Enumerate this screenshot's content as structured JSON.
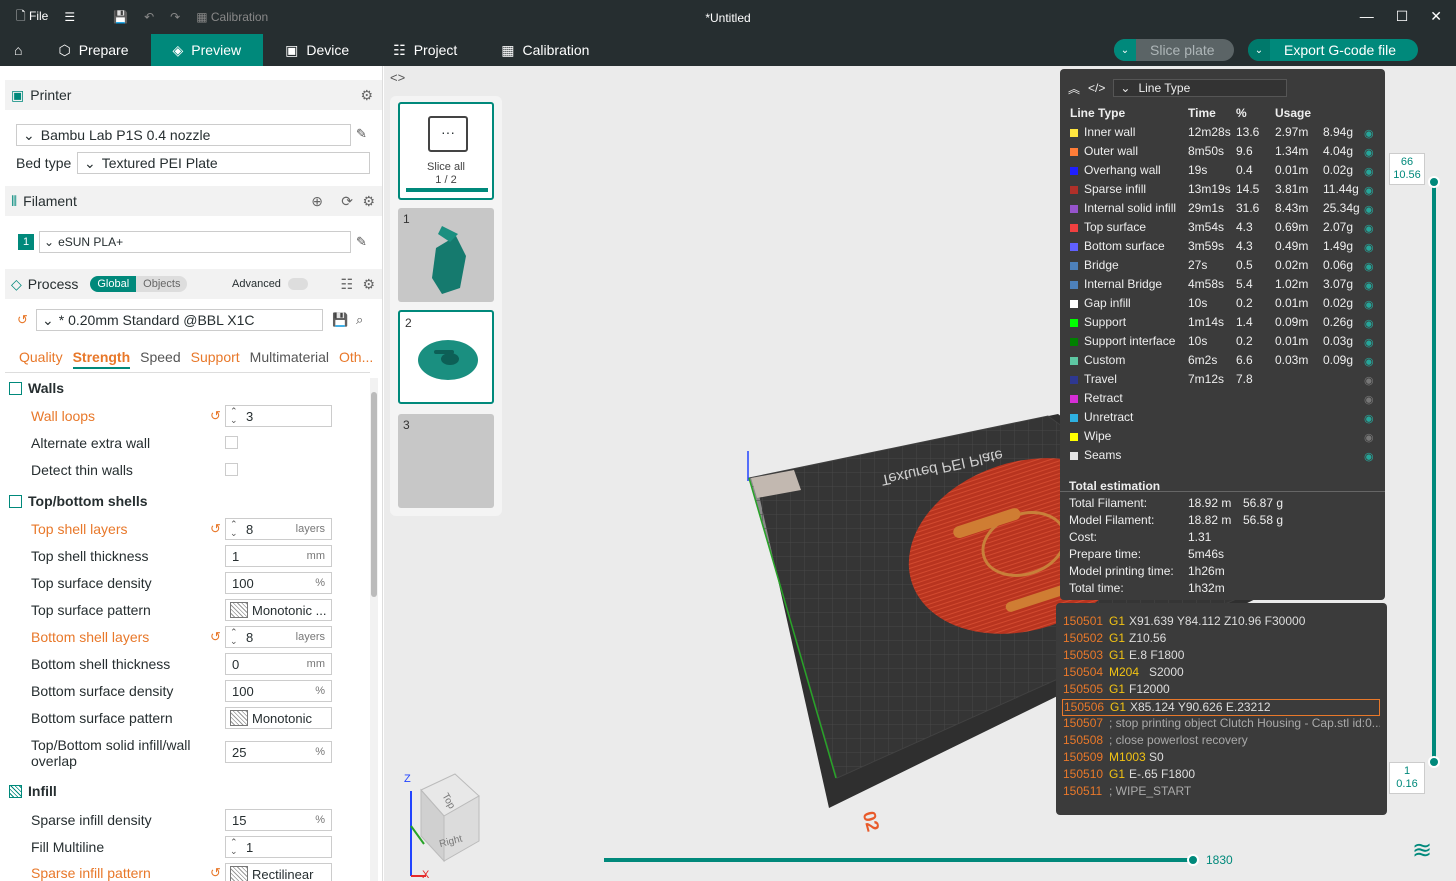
{
  "titlebar": {
    "file_label": "File",
    "calibration_label": "Calibration",
    "title": "*Untitled"
  },
  "nav": {
    "items": [
      {
        "label": "Prepare"
      },
      {
        "label": "Preview"
      },
      {
        "label": "Device"
      },
      {
        "label": "Project"
      },
      {
        "label": "Calibration"
      }
    ],
    "slice_label": "Slice plate",
    "export_label": "Export G-code file"
  },
  "printer": {
    "header": "Printer",
    "model": "Bambu Lab P1S 0.4 nozzle",
    "bed_label": "Bed type",
    "bed_value": "Textured PEI Plate"
  },
  "filament": {
    "header": "Filament",
    "slot": "1",
    "name": "eSUN PLA+"
  },
  "process": {
    "header": "Process",
    "global": "Global",
    "objects": "Objects",
    "advanced": "Advanced",
    "preset": "* 0.20mm Standard @BBL X1C",
    "tabs": [
      "Quality",
      "Strength",
      "Speed",
      "Support",
      "Multimaterial",
      "Oth..."
    ]
  },
  "walls": {
    "header": "Walls",
    "wall_loops": "Wall loops",
    "wall_loops_value": "3",
    "alt_extra": "Alternate extra wall",
    "thin": "Detect thin walls"
  },
  "shells": {
    "header": "Top/bottom shells",
    "rows": [
      {
        "label": "Top shell layers",
        "value": "8",
        "unit": "layers"
      },
      {
        "label": "Top shell thickness",
        "value": "1",
        "unit": "mm"
      },
      {
        "label": "Top surface density",
        "value": "100",
        "unit": "%"
      },
      {
        "label": "Top surface pattern",
        "value": "Monotonic ...",
        "unit": ""
      },
      {
        "label": "Bottom shell layers",
        "value": "8",
        "unit": "layers"
      },
      {
        "label": "Bottom shell thickness",
        "value": "0",
        "unit": "mm"
      },
      {
        "label": "Bottom surface density",
        "value": "100",
        "unit": "%"
      },
      {
        "label": "Bottom surface pattern",
        "value": "Monotonic",
        "unit": ""
      }
    ],
    "overlap_l1": "Top/Bottom solid infill/wall",
    "overlap_l2": "overlap",
    "overlap_value": "25",
    "overlap_unit": "%"
  },
  "infill": {
    "header": "Infill",
    "density": "Sparse infill density",
    "density_value": "15",
    "density_unit": "%",
    "multiline": "Fill Multiline",
    "multiline_value": "1",
    "pattern": "Sparse infill pattern",
    "pattern_value": "Rectilinear"
  },
  "plates": {
    "slice_all": "Slice all",
    "progress": "1 / 2",
    "p1": "1",
    "p2": "2",
    "p3": "3"
  },
  "linetype": {
    "selector": "Line Type",
    "cols": {
      "type": "Line Type",
      "time": "Time",
      "pct": "%",
      "usage": "Usage"
    },
    "rows": [
      {
        "name": "Inner wall",
        "color": "#ffe640",
        "time": "12m28s",
        "pct": "13.6",
        "len": "2.97m",
        "w": "8.94g"
      },
      {
        "name": "Outer wall",
        "color": "#ff7d38",
        "time": "8m50s",
        "pct": "9.6",
        "len": "1.34m",
        "w": "4.04g"
      },
      {
        "name": "Overhang wall",
        "color": "#1f1fff",
        "time": "19s",
        "pct": "0.4",
        "len": "0.01m",
        "w": "0.02g"
      },
      {
        "name": "Sparse infill",
        "color": "#b03029",
        "time": "13m19s",
        "pct": "14.5",
        "len": "3.81m",
        "w": "11.44g"
      },
      {
        "name": "Internal solid infill",
        "color": "#9654cc",
        "time": "29m1s",
        "pct": "31.6",
        "len": "8.43m",
        "w": "25.34g"
      },
      {
        "name": "Top surface",
        "color": "#f04040",
        "time": "3m54s",
        "pct": "4.3",
        "len": "0.69m",
        "w": "2.07g"
      },
      {
        "name": "Bottom surface",
        "color": "#6060ff",
        "time": "3m59s",
        "pct": "4.3",
        "len": "0.49m",
        "w": "1.49g"
      },
      {
        "name": "Bridge",
        "color": "#4d80ba",
        "time": "27s",
        "pct": "0.5",
        "len": "0.02m",
        "w": "0.06g"
      },
      {
        "name": "Internal Bridge",
        "color": "#4d80ba",
        "time": "4m58s",
        "pct": "5.4",
        "len": "1.02m",
        "w": "3.07g"
      },
      {
        "name": "Gap infill",
        "color": "#ffffff",
        "time": "10s",
        "pct": "0.2",
        "len": "0.01m",
        "w": "0.02g"
      },
      {
        "name": "Support",
        "color": "#00ff00",
        "time": "1m14s",
        "pct": "1.4",
        "len": "0.09m",
        "w": "0.26g"
      },
      {
        "name": "Support interface",
        "color": "#008000",
        "time": "10s",
        "pct": "0.2",
        "len": "0.01m",
        "w": "0.03g"
      },
      {
        "name": "Custom",
        "color": "#5ec7a3",
        "time": "6m2s",
        "pct": "6.6",
        "len": "0.03m",
        "w": "0.09g"
      },
      {
        "name": "Travel",
        "color": "#2e3891",
        "time": "7m12s",
        "pct": "7.8",
        "len": "",
        "w": ""
      },
      {
        "name": "Retract",
        "color": "#d62ed6",
        "time": "",
        "pct": "",
        "len": "",
        "w": ""
      },
      {
        "name": "Unretract",
        "color": "#2eb0e0",
        "time": "",
        "pct": "",
        "len": "",
        "w": ""
      },
      {
        "name": "Wipe",
        "color": "#ffff00",
        "time": "",
        "pct": "",
        "len": "",
        "w": ""
      },
      {
        "name": "Seams",
        "color": "#e6e6e6",
        "time": "",
        "pct": "",
        "len": "",
        "w": ""
      }
    ],
    "est_header": "Total estimation",
    "est": [
      {
        "k": "Total Filament:",
        "a": "18.92 m",
        "b": "56.87 g"
      },
      {
        "k": "Model Filament:",
        "a": "18.82 m",
        "b": "56.58 g"
      },
      {
        "k": "Cost:",
        "a": "1.31",
        "b": ""
      },
      {
        "k": "Prepare time:",
        "a": "5m46s",
        "b": ""
      },
      {
        "k": "Model printing time:",
        "a": "1h26m",
        "b": ""
      },
      {
        "k": "Total time:",
        "a": "1h32m",
        "b": ""
      }
    ]
  },
  "gcode": [
    {
      "ln": "150501",
      "cmd": "G1",
      "args": "X91.639 Y84.112 Z10.96 F30000"
    },
    {
      "ln": "150502",
      "cmd": "G1",
      "args": "Z10.56"
    },
    {
      "ln": "150503",
      "cmd": "G1",
      "args": "E.8 F1800"
    },
    {
      "ln": "150504",
      "cmd": "M204",
      "args": "S2000"
    },
    {
      "ln": "150505",
      "cmd": "G1",
      "args": "F12000"
    },
    {
      "ln": "150506",
      "cmd": "G1",
      "args": "X85.124 Y90.626 E.23212"
    },
    {
      "ln": "150507",
      "cmd": "",
      "args": "; stop printing object Clutch Housing - Cap.stl id:0..."
    },
    {
      "ln": "150508",
      "cmd": "",
      "args": "; close powerlost recovery"
    },
    {
      "ln": "150509",
      "cmd": "M1003",
      "args": "S0"
    },
    {
      "ln": "150510",
      "cmd": "G1",
      "args": "E-.65 F1800"
    },
    {
      "ln": "150511",
      "cmd": "",
      "args": "; WIPE_START"
    }
  ],
  "vslider": {
    "top_layer": "66",
    "top_height": "10.56",
    "bottom_layer": "1",
    "bottom_height": "0.16"
  },
  "hslider": {
    "value": "1830"
  },
  "viewcube": {
    "top": "Top",
    "right": "Right"
  },
  "axes": {
    "z": "Z",
    "x": "X"
  },
  "plate_number": "02",
  "plate_text": "Textured PEI Plate"
}
